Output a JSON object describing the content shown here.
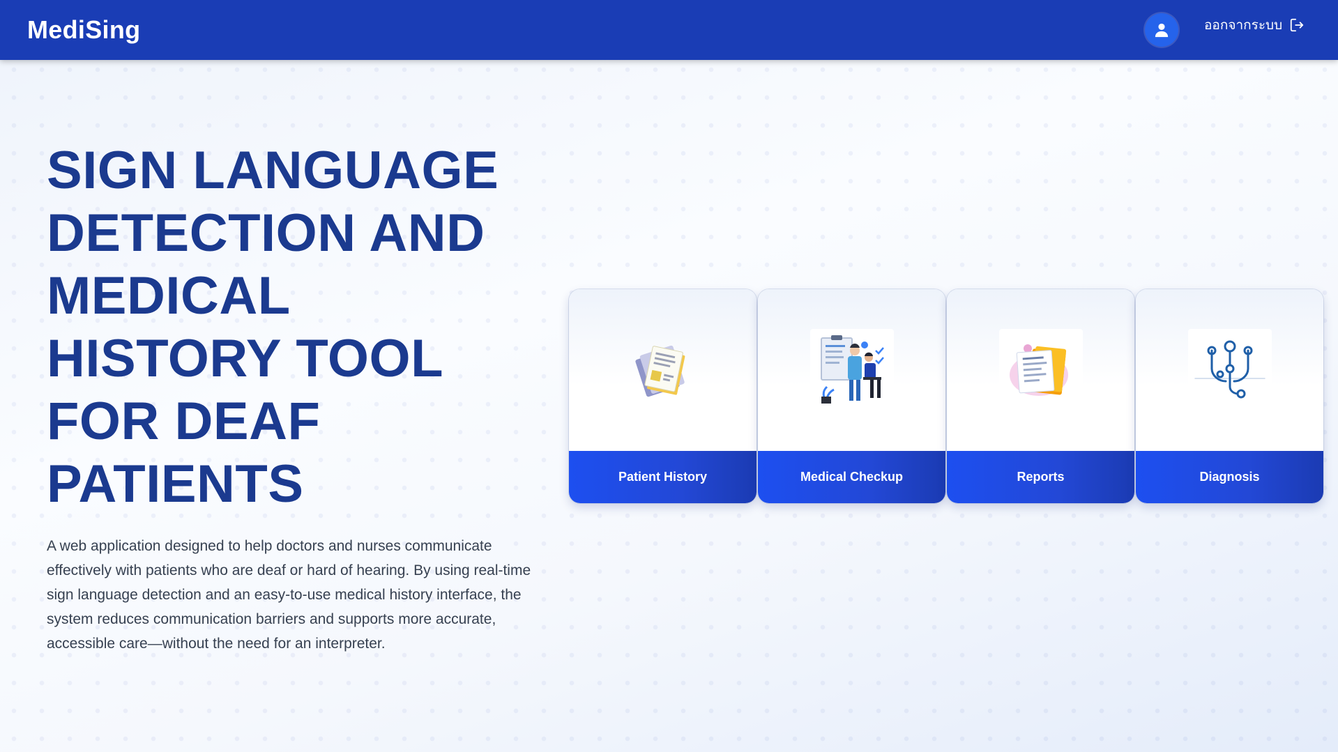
{
  "header": {
    "brand": "MediSing",
    "logout_label": "ออกจากระบบ",
    "icons": {
      "avatar": "user-icon",
      "logout": "logout-arrow-icon"
    }
  },
  "hero": {
    "title": "SIGN LANGUAGE DETECTION AND MEDICAL HISTORY TOOL FOR DEAF PATIENTS",
    "description": "A web application designed to help doctors and nurses communicate effectively with patients who are deaf or hard of hearing. By using real-time sign language detection and an easy-to-use medical history interface, the system reduces communication barriers and supports more accurate, accessible care—without the need for an interpreter."
  },
  "cards": [
    {
      "label": "Patient History",
      "icon": "documents-icon"
    },
    {
      "label": "Medical Checkup",
      "icon": "doctor-patient-icon"
    },
    {
      "label": "Reports",
      "icon": "report-folder-icon"
    },
    {
      "label": "Diagnosis",
      "icon": "stethoscope-icon"
    }
  ],
  "colors": {
    "navbar": "#1a3db5",
    "title": "#1b3a8f",
    "button": "#1d4ff0",
    "avatar": "#2563eb"
  }
}
